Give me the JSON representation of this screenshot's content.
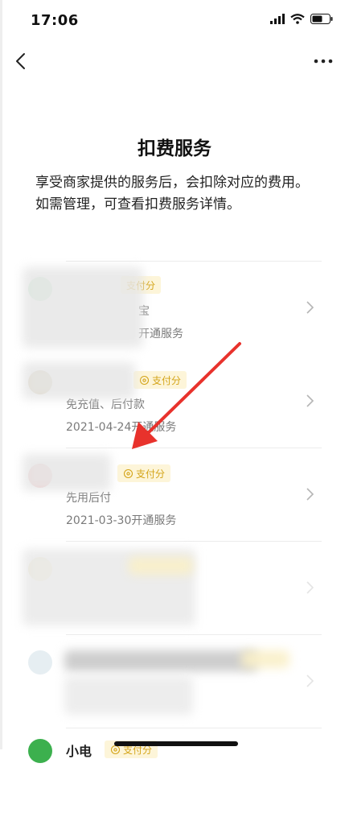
{
  "status_bar": {
    "time": "17:06"
  },
  "page": {
    "title": "扣费服务",
    "description": "享受商家提供的服务后，会扣除对应的费用。如需管理，可查看扣费服务详情。"
  },
  "services": [
    {
      "name": "",
      "badge": "支付分",
      "subtitle": "宝",
      "date": "开通服务",
      "logo_color": "#c7ebd1"
    },
    {
      "name": "",
      "badge": "支付分",
      "subtitle": "免充值、后付款",
      "date": "2021-04-24开通服务",
      "logo_color": "#d8cdb2"
    },
    {
      "name": "",
      "badge": "支付分",
      "subtitle": "先用后付",
      "date": "2021-03-30开通服务",
      "logo_color": "#f1c5c5"
    },
    {
      "name": "",
      "badge": "",
      "subtitle": "",
      "date": "",
      "logo_color": "#ede3b6"
    },
    {
      "name": "",
      "badge": "",
      "subtitle": "",
      "date": "",
      "logo_color": "#e6eef2"
    },
    {
      "name": "小电",
      "badge": "支付分",
      "subtitle": "",
      "date": "",
      "logo_color": "#3cb04e"
    }
  ],
  "colors": {
    "badge_bg": "#fdf5d9",
    "badge_text": "#d4a418",
    "annotation_arrow": "#e8322c"
  }
}
